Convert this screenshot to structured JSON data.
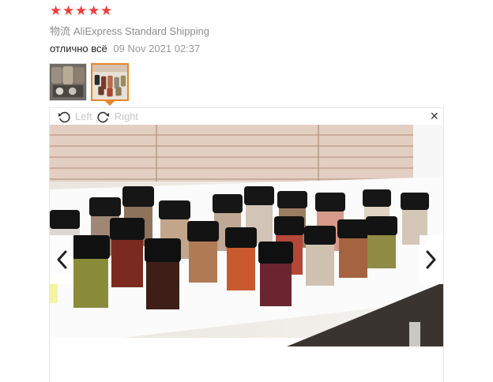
{
  "review": {
    "rating_stars": [
      "★",
      "★",
      "★",
      "★",
      "★"
    ],
    "logistics_label": "物流",
    "shipping_method": "AliExpress Standard Shipping",
    "text": "отлично всё",
    "date": "09 Nov 2021 02:37"
  },
  "viewer": {
    "rotate_left_label": "Left",
    "rotate_right_label": "Right",
    "close_symbol": "×"
  },
  "colors": {
    "star": "#f23c3c",
    "active_thumb_border": "#e8862a"
  }
}
